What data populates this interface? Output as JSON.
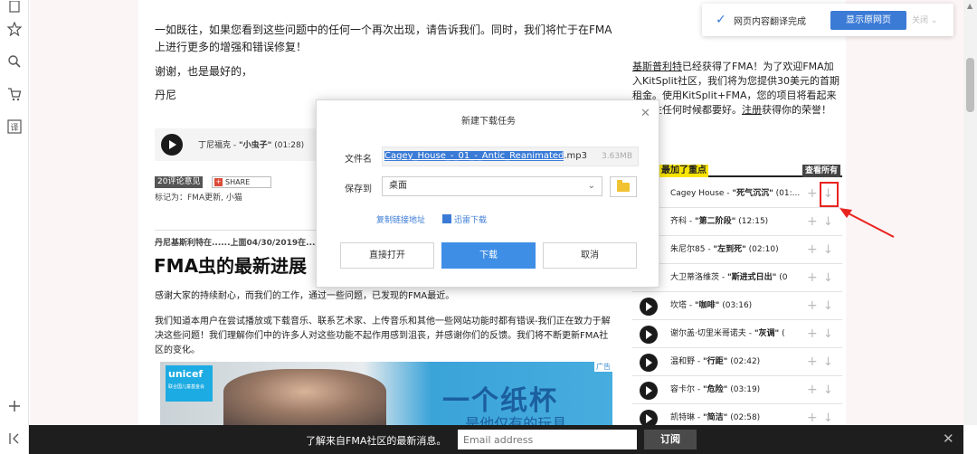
{
  "article": {
    "intro_text": "一如既往，如果您看到这些问题中的任何一个再次出现，请告诉我们。同时，我们将忙于在FMA上进行更多的增强和错误修复！",
    "thanks": "谢谢，也是最好的，",
    "signature": "丹尼",
    "player_artist": "丁尼福克 - ",
    "player_title": "\"小虫子\"",
    "player_duration": " (01:28)",
    "comments_tag": "20评论意见",
    "share_label": "SHARE",
    "tags_text": "标记为：FMA更新, 小猫",
    "byline": "丹尼基斯利特在......上面04/30/2019在...上午",
    "headline": "FMA虫的最新进展",
    "para1": "感谢大家的持续耐心，而我们的工作，通过一些问题，已发现的FMA最近。",
    "para2": "我们知道本用户在尝试播放或下载音乐、联系艺术家、上传音乐和其他一些网站功能时都有错误-我们正在致力于解决这些问题！我们理解你们中的许多人对这些功能不起作用感到沮丧，并感谢你们的反馈。我们将不断更新FMA社区的变化。"
  },
  "ad": {
    "brand": "unicef",
    "brand_sub": "联合国儿童基金会",
    "text_line1": "一个纸杯",
    "text_line2": "...是他仅有的玩具",
    "badge": "广告"
  },
  "right_column": {
    "promo_user": "基斯普利特",
    "promo_text": "已经获得了FMA！为了欢迎FMA加入KitSplit社区，我们将为您提供30美元的首期租金。使用KitSplit+FMA，您的项目将看起来比以往任何时候都要好。",
    "promo_link": "注册",
    "promo_tail": "获得你的荣誉！",
    "fav_label": "最加了重点",
    "view_all": "查看所有",
    "tracks": [
      {
        "artist": "Cagey House - ",
        "title": "\"死气沉沉\"",
        "duration": " (01:..."
      },
      {
        "artist": "齐科 - ",
        "title": "\"第二阶段\"",
        "duration": " (12:15)"
      },
      {
        "artist": "朱尼尔85 - ",
        "title": "\"左到死\"",
        "duration": " (02:10)"
      },
      {
        "artist": "大卫蒂洛维茨 - ",
        "title": "\"斯进式日出\"",
        "duration": " (0"
      },
      {
        "artist": "坎塔 - ",
        "title": "\"咖啡\"",
        "duration": " (03:16)"
      },
      {
        "artist": "谢尔盖·切里米哥诺夫 - ",
        "title": "\"灰调\"",
        "duration": " ("
      },
      {
        "artist": "温和野 - ",
        "title": "\"行距\"",
        "duration": " (02:42)"
      },
      {
        "artist": "容卡尔 - ",
        "title": "\"危险\"",
        "duration": " (03:19)"
      },
      {
        "artist": "凯特琳 - ",
        "title": "\"简洁\"",
        "duration": " (02:58)"
      }
    ]
  },
  "translation_bar": {
    "status": "网页内容翻译完成",
    "show_original": "显示原网页",
    "close": "关闭"
  },
  "download_dialog": {
    "title": "新建下载任务",
    "filename_label": "文件名",
    "filename_selected": "Cagey_House_-_01_-_Antic_Reanimated",
    "filename_ext": ".mp3",
    "file_size": "3.63MB",
    "save_label": "保存到",
    "save_location": "桌面",
    "copy_link": "复制链接地址",
    "thunder_download": "迅雷下载",
    "btn_open": "直接打开",
    "btn_download": "下载",
    "btn_cancel": "取消"
  },
  "footer": {
    "text": "了解来自FMA社区的最新消息。",
    "email_placeholder": "Email address",
    "subscribe": "订阅"
  },
  "colors": {
    "accent": "#3b7bd6",
    "highlight_box": "#e8231f",
    "favorite_highlight": "#f8e400"
  }
}
